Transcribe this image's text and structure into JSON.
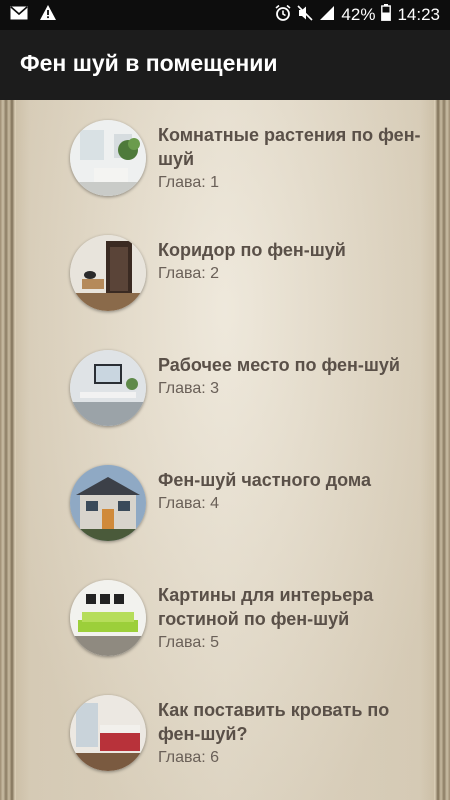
{
  "statusbar": {
    "icons_left": [
      "mail-icon",
      "warning-icon"
    ],
    "battery": "42%",
    "time": "14:23"
  },
  "appbar": {
    "title": "Фен шуй в помещении"
  },
  "items": [
    {
      "title": "Комнатные растения по фен-шуй",
      "subtitle": "Глава: 1"
    },
    {
      "title": "Коридор по фен-шуй",
      "subtitle": "Глава: 2"
    },
    {
      "title": "Рабочее место по фен-шуй",
      "subtitle": "Глава: 3"
    },
    {
      "title": "Фен-шуй частного дома",
      "subtitle": "Глава: 4"
    },
    {
      "title": "Картины для интерьера гостиной по фен-шуй",
      "subtitle": "Глава: 5"
    },
    {
      "title": "Как поставить кровать по фен-шуй?",
      "subtitle": "Глава: 6"
    }
  ]
}
